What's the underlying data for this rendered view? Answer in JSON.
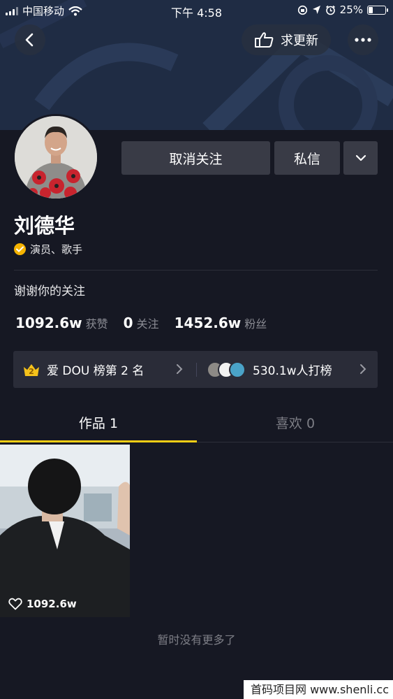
{
  "status_bar": {
    "carrier": "中国移动",
    "time": "下午 4:58",
    "battery_percent": "25%",
    "battery_level": 0.25
  },
  "nav": {
    "request_update_label": "求更新"
  },
  "profile": {
    "unfollow_label": "取消关注",
    "message_label": "私信",
    "name": "刘德华",
    "verified_text": "演员、歌手",
    "bio": "谢谢你的关注",
    "stats": [
      {
        "value": "1092.6w",
        "label": "获赞"
      },
      {
        "value": "0",
        "label": "关注"
      },
      {
        "value": "1452.6w",
        "label": "粉丝"
      }
    ]
  },
  "ranking": {
    "badge_number": "2",
    "rank_text": "爱 DOU 榜第 2 名",
    "supporters_text": "530.1w人打榜"
  },
  "tabs": {
    "works": "作品 1",
    "likes": "喜欢 0"
  },
  "video": {
    "like_count": "1092.6w"
  },
  "footer": {
    "no_more": "暂时没有更多了",
    "watermark": "首码项目网 www.shenli.cc"
  },
  "colors": {
    "background": "#161823",
    "accent": "#face15",
    "button": "#393b46",
    "verified": "#f5b300"
  },
  "icons": [
    "signal-icon",
    "wifi-icon",
    "lock-rotation-icon",
    "location-icon",
    "alarm-icon",
    "battery-icon",
    "back-icon",
    "hand-pointer-icon",
    "more-icon",
    "chevron-down-icon",
    "verified-icon",
    "crown-icon",
    "chevron-right-icon",
    "heart-icon"
  ]
}
